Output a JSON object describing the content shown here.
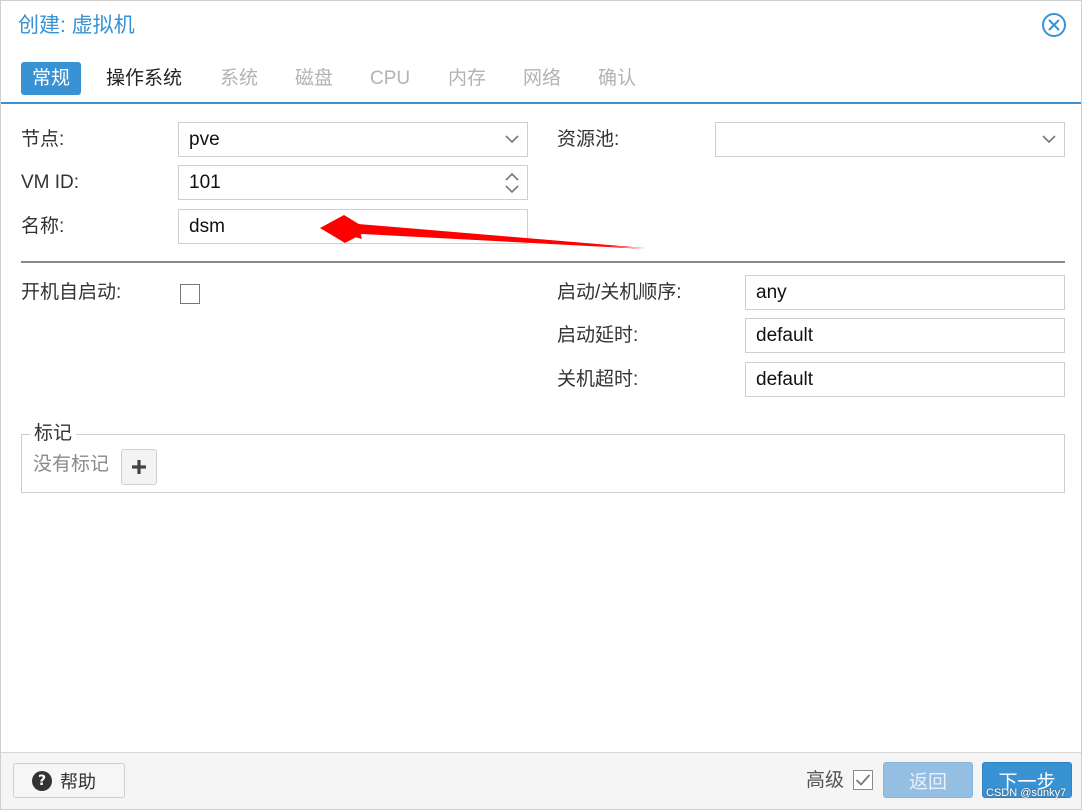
{
  "dialog": {
    "title": "创建: 虚拟机"
  },
  "tabs": [
    {
      "label": "常规",
      "state": "active"
    },
    {
      "label": "操作系统",
      "state": "enabled"
    },
    {
      "label": "系统",
      "state": "disabled"
    },
    {
      "label": "磁盘",
      "state": "disabled"
    },
    {
      "label": "CPU",
      "state": "disabled"
    },
    {
      "label": "内存",
      "state": "disabled"
    },
    {
      "label": "网络",
      "state": "disabled"
    },
    {
      "label": "确认",
      "state": "disabled"
    }
  ],
  "general": {
    "node_label": "节点:",
    "node_value": "pve",
    "resource_pool_label": "资源池:",
    "resource_pool_value": "",
    "vmid_label": "VM ID:",
    "vmid_value": "101",
    "name_label": "名称:",
    "name_value": "dsm",
    "onboot_label": "开机自启动:",
    "onboot_checked": false,
    "startup_order_label": "启动/关机顺序:",
    "startup_order_value": "any",
    "startup_delay_label": "启动延时:",
    "startup_delay_value": "default",
    "shutdown_timeout_label": "关机超时:",
    "shutdown_timeout_value": "default"
  },
  "tags": {
    "legend": "标记",
    "empty_text": "没有标记"
  },
  "footer": {
    "help_label": "帮助",
    "advanced_label": "高级",
    "advanced_checked": true,
    "back_label": "返回",
    "next_label": "下一步"
  },
  "watermark": "CSDN @sunky7",
  "colors": {
    "accent": "#3892d3",
    "annotation_arrow": "#ff0000"
  }
}
